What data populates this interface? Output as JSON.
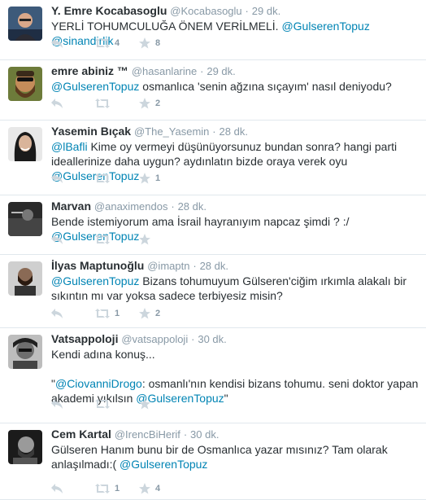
{
  "colors": {
    "link": "#0084b4",
    "muted": "#8899a6",
    "text": "#292f33",
    "action": "#ccd6dd",
    "divider": "#e1e8ed"
  },
  "icons": {
    "reply": "reply-icon",
    "retweet": "retweet-icon",
    "favorite": "star-icon",
    "more": "more-icon"
  },
  "tweets": [
    {
      "name": "Y. Emre Kocabasoglu",
      "handle": "@Kocabasoglu",
      "sep": "·",
      "time": "29 dk.",
      "segments": [
        {
          "t": "YERLİ TOHUMCULUĞA ÖNEM VERİLMELİ. "
        },
        {
          "t": "@GulserenTopuz",
          "m": true
        },
        {
          "t": " "
        },
        {
          "t": "@sinandirlik",
          "m": true
        }
      ],
      "retweets": "4",
      "favorites": "8"
    },
    {
      "name": "emre abiniz ™",
      "handle": "@hasanlarine",
      "sep": "·",
      "time": "29 dk.",
      "segments": [
        {
          "t": "@GulserenTopuz",
          "m": true
        },
        {
          "t": " osmanlıca 'senin ağzına sıçayım' nasıl deniyodu?"
        }
      ],
      "retweets": "",
      "favorites": "2"
    },
    {
      "name": "Yasemin Bıçak",
      "handle": "@The_Yasemin",
      "sep": "·",
      "time": "28 dk.",
      "segments": [
        {
          "t": "@lBafli",
          "m": true
        },
        {
          "t": " Kime oy vermeyi düşünüyorsunuz bundan sonra? hangi parti ideallerinize daha uygun? aydınlatın bizde oraya verek oyu "
        },
        {
          "t": "@GulserenTopuz",
          "m": true
        }
      ],
      "retweets": "",
      "favorites": "1"
    },
    {
      "name": "Marvan",
      "handle": "@anaximendos",
      "sep": "·",
      "time": "28 dk.",
      "segments": [
        {
          "t": "Bende istemiyorum ama İsrail hayranıyım napcaz şimdi ? :/ "
        },
        {
          "t": "@GulserenTopuz",
          "m": true
        }
      ],
      "retweets": "",
      "favorites": ""
    },
    {
      "name": "İlyas Maptunoğlu",
      "handle": "@imaptn",
      "sep": "·",
      "time": "28 dk.",
      "segments": [
        {
          "t": "@GulserenTopuz",
          "m": true
        },
        {
          "t": " Bizans tohumuyum Gülseren'ciğim ırkımla alakalı bir sıkıntın mı var yoksa sadece terbiyesiz misin?"
        }
      ],
      "retweets": "1",
      "favorites": "2"
    },
    {
      "name": "Vatsappoloji",
      "handle": "@vatsappoloji",
      "sep": "·",
      "time": "30 dk.",
      "segments": [
        {
          "t": "Kendi adına konuş..."
        },
        {
          "br": true
        },
        {
          "br": true
        },
        {
          "t": "\""
        },
        {
          "t": "@CiovanniDrogo",
          "m": true
        },
        {
          "t": ": osmanlı'nın kendisi bizans tohumu. seni doktor yapan akademi yıkılsın "
        },
        {
          "t": "@GulserenTopuz",
          "m": true
        },
        {
          "t": "\""
        }
      ],
      "retweets": "",
      "favorites": ""
    },
    {
      "name": "Cem Kartal",
      "handle": "@IrencBiHerif",
      "sep": "·",
      "time": "30 dk.",
      "segments": [
        {
          "t": "Gülseren Hanım bunu bir de Osmanlıca yazar mısınız? Tam olarak anlaşılmadı:( "
        },
        {
          "t": "@GulserenTopuz",
          "m": true
        }
      ],
      "retweets": "1",
      "favorites": "4"
    }
  ]
}
